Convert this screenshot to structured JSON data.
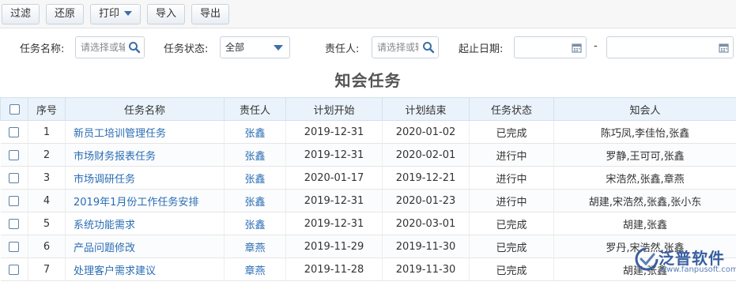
{
  "toolbar": {
    "filter_label": "过滤",
    "restore_label": "还原",
    "print_label": "打印",
    "import_label": "导入",
    "export_label": "导出"
  },
  "filters": {
    "task_name_label": "任务名称:",
    "task_name_placeholder": "请选择或输",
    "task_status_label": "任务状态:",
    "task_status_value": "全部",
    "owner_label": "责任人:",
    "owner_placeholder": "请选择或输",
    "date_range_label": "起止日期:",
    "date_separator": "-"
  },
  "page_title": "知会任务",
  "table": {
    "headers": [
      "序号",
      "任务名称",
      "责任人",
      "计划开始",
      "计划结束",
      "任务状态",
      "知会人"
    ],
    "rows": [
      {
        "no": "1",
        "name": "新员工培训管理任务",
        "owner": "张鑫",
        "start": "2019-12-31",
        "end": "2020-01-02",
        "status": "已完成",
        "notify": "陈巧凤,李佳怡,张鑫"
      },
      {
        "no": "2",
        "name": "市场财务报表任务",
        "owner": "张鑫",
        "start": "2019-12-31",
        "end": "2020-02-01",
        "status": "进行中",
        "notify": "罗静,王可可,张鑫"
      },
      {
        "no": "3",
        "name": "市场调研任务",
        "owner": "张鑫",
        "start": "2020-01-17",
        "end": "2019-12-21",
        "status": "进行中",
        "notify": "宋浩然,张鑫,章燕"
      },
      {
        "no": "4",
        "name": "2019年1月份工作任务安排",
        "owner": "张鑫",
        "start": "2019-12-31",
        "end": "2020-01-23",
        "status": "进行中",
        "notify": "胡建,宋浩然,张鑫,张小东"
      },
      {
        "no": "5",
        "name": "系统功能需求",
        "owner": "张鑫",
        "start": "2019-12-31",
        "end": "2020-03-01",
        "status": "已完成",
        "notify": "胡建,张鑫"
      },
      {
        "no": "6",
        "name": "产品问题修改",
        "owner": "章燕",
        "start": "2019-11-29",
        "end": "2019-11-30",
        "status": "已完成",
        "notify": "罗丹,宋浩然,张鑫"
      },
      {
        "no": "7",
        "name": "处理客户需求建议",
        "owner": "章燕",
        "start": "2019-11-28",
        "end": "2019-11-30",
        "status": "已完成",
        "notify": "胡建,张鑫"
      }
    ]
  },
  "watermark": {
    "brand_cn": "泛普软件",
    "brand_en": "www.fanpusoft.com"
  },
  "colors": {
    "link": "#2a6db4",
    "header_bg": "#eaf3fb",
    "accent": "#3b6fa8"
  }
}
